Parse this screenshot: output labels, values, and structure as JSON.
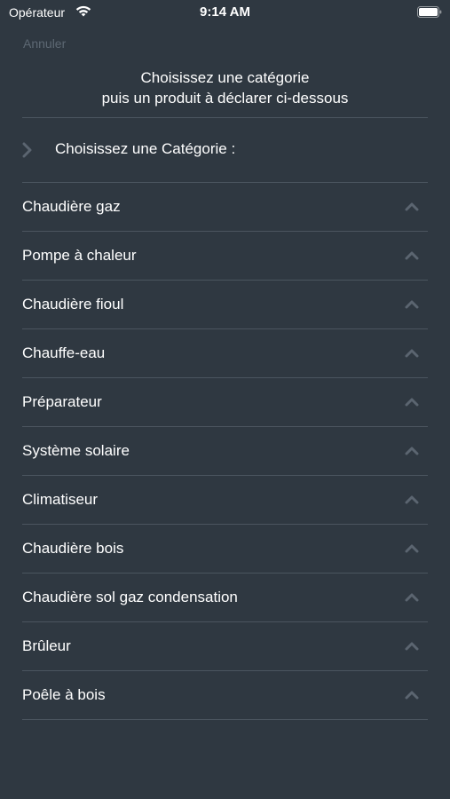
{
  "status_bar": {
    "carrier": "Opérateur",
    "time": "9:14 AM"
  },
  "header": {
    "cancel_label": "Annuler",
    "instruction_line1": "Choisissez une catégorie",
    "instruction_line2": "puis un produit à déclarer ci-dessous"
  },
  "category_selector": {
    "label": "Choisissez une Catégorie :"
  },
  "categories": [
    {
      "label": "Chaudière gaz"
    },
    {
      "label": "Pompe à chaleur"
    },
    {
      "label": "Chaudière fioul"
    },
    {
      "label": "Chauffe-eau"
    },
    {
      "label": "Préparateur"
    },
    {
      "label": "Système solaire"
    },
    {
      "label": "Climatiseur"
    },
    {
      "label": "Chaudière bois"
    },
    {
      "label": "Chaudière sol gaz condensation"
    },
    {
      "label": "Brûleur"
    },
    {
      "label": "Poêle à bois"
    }
  ],
  "colors": {
    "background": "#2f3841",
    "divider": "#4b555f",
    "muted_text": "#5d6873",
    "chevron": "#5b6570"
  }
}
